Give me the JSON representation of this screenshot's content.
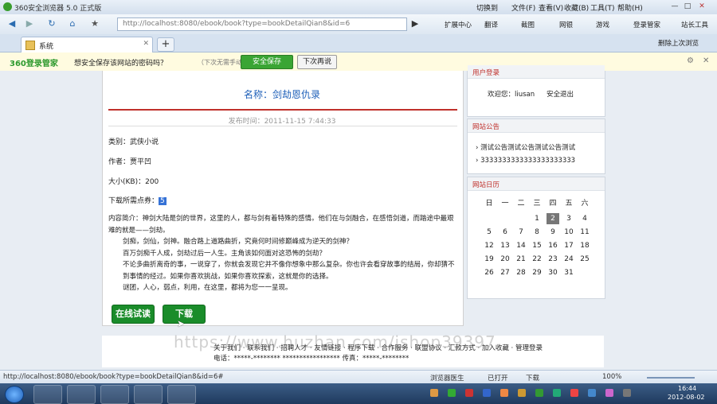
{
  "browser": {
    "title": "360安全浏览器 5.0 正式版",
    "menu": [
      "切换到",
      "文件(F)",
      "查看(V)",
      "收藏(B)",
      "工具(T)",
      "帮助(H)"
    ],
    "url": "http://localhost:8080/ebook/book?type=bookDetailQian8&id=6",
    "toolbar": [
      "扩展中心",
      "翻译",
      "截图",
      "网银",
      "游戏",
      "登录管家",
      "站长工具"
    ],
    "right_tools": "删除上次浏览",
    "tab_label": "系统",
    "newtab_label": "+"
  },
  "password_bar": {
    "brand": "360登录管家",
    "question": "想安全保存该网站的密码吗？",
    "hint": "（下次无需手动输入）",
    "save_label": "安全保存",
    "later_label": "下次再说"
  },
  "book": {
    "title": "名称：剑劫恩仇录",
    "pub_time": "发布时间：2011-11-15 7:44:33",
    "category": "类别：武侠小说",
    "author": "作者：贾平凹",
    "size": "大小(KB)：200",
    "points_label": "下载所需点券：",
    "points_value": "5",
    "desc": [
      "内容简介：神剑大陆是剑的世界，这里的人，都与剑有着特殊的感情。他们在与剑融合，在感悟剑道，而踏途中最艰难的就是——剑劫。",
      "剑痴，剑仙，剑神。融合路上道路曲折，究竟何时间修巅峰成为逆天的剑神？",
      "百万剑痴千人成，剑劫过后一人生。主角该如何面对这恐怖的剑劫？",
      "不论多曲折离奇的事，一说穿了，你就会发现它并不像你想象中那么复杂。你也许会看穿故事的结局，你却猜不到事情的经过。如果你喜欢挑战，如果你喜欢探索，这就是你的选择。",
      "谜团，人心，弱点，利用，在这里，都将为您一一呈现。"
    ],
    "read_online_label": "在线试读",
    "download_label": "下载"
  },
  "sidebar": {
    "user_head": "用户登录",
    "welcome": "欢迎您：liusan",
    "logout": "安全退出",
    "notice_head": "网站公告",
    "notices": [
      "测试公告测试公告测试公告测试",
      "3333333333333333333333"
    ],
    "calendar_head": "网站日历",
    "weekdays": [
      "日",
      "一",
      "二",
      "三",
      "四",
      "五",
      "六"
    ],
    "days": [
      "",
      "",
      "",
      "1",
      "2",
      "3",
      "4",
      "5",
      "6",
      "7",
      "8",
      "9",
      "10",
      "11",
      "12",
      "13",
      "14",
      "15",
      "16",
      "17",
      "18",
      "19",
      "20",
      "21",
      "22",
      "23",
      "24",
      "25",
      "26",
      "27",
      "28",
      "29",
      "30",
      "31"
    ],
    "today": "2"
  },
  "footer": {
    "links": "关于我们 · 联系我们 · 招聘人才 · 友情链接 · 程序下载 · 合作服务 · 联盟协议 · 汇款方式 · 加入收藏 · 管理登录",
    "contact": "电话：*****-********  *****************  传真：*****-********",
    "watermark": "https://www.huzhan.com/ishop39397"
  },
  "status": {
    "link": "http://localhost:8080/ebook/book?type=bookDetailQian8&id=6#",
    "items": [
      "浏览器医生",
      "已打开",
      "下载",
      "100%"
    ]
  },
  "taskbar": {
    "time": "16:44",
    "date": "2012-08-02"
  },
  "colors": {
    "accent_green": "#1a8c2a",
    "title_blue": "#1d5fb8",
    "rule_red": "#c0302b"
  }
}
